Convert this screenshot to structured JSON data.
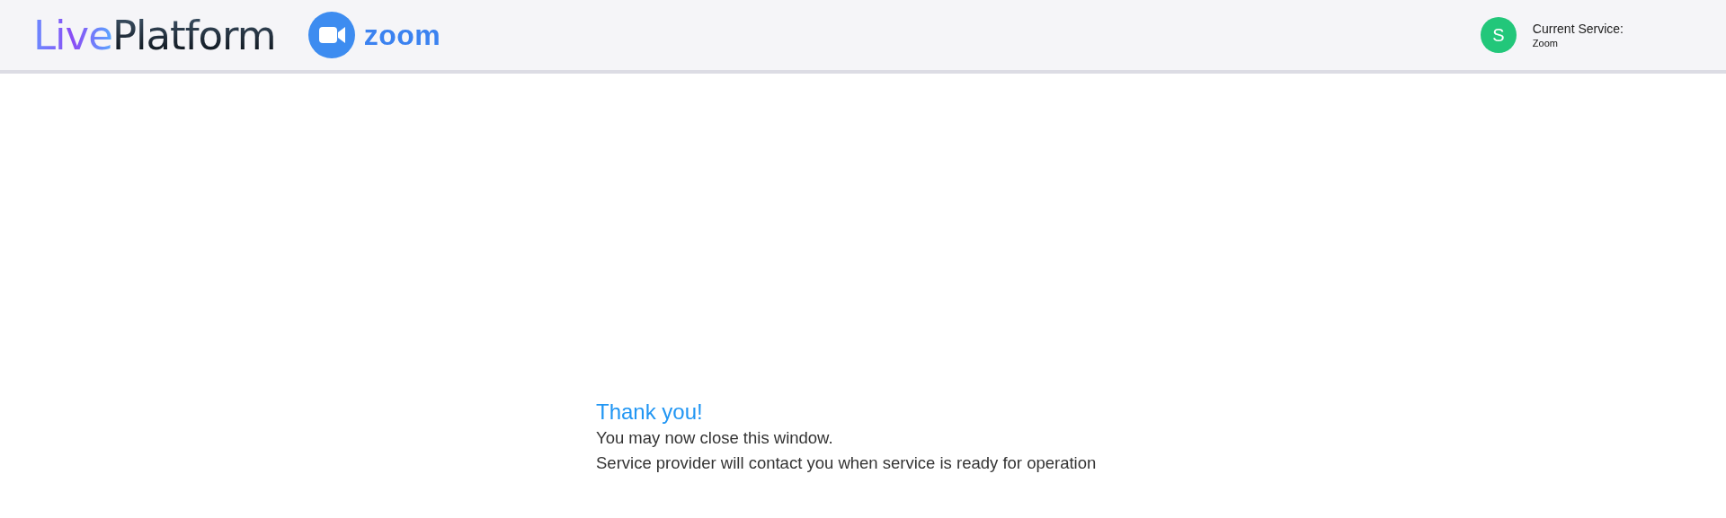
{
  "header": {
    "brand": {
      "accent": "Live",
      "rest": "Platform"
    },
    "partner": {
      "name": "zoom"
    },
    "user": {
      "initial": "S",
      "color": "#22c77a",
      "label": "Current Service:",
      "service": "Zoom"
    }
  },
  "message": {
    "title": "Thank you!",
    "lines": [
      "You may now close this window.",
      "Service provider will contact you when service is ready for operation"
    ]
  }
}
